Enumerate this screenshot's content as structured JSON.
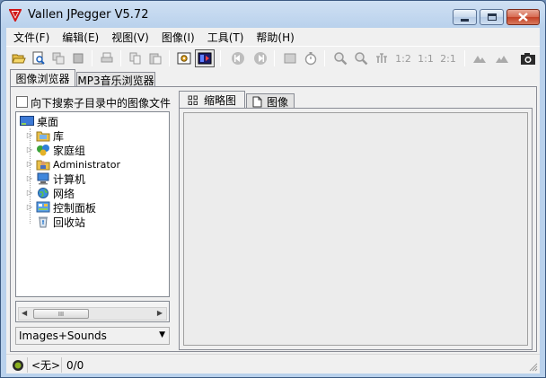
{
  "window": {
    "title": "Vallen JPegger V5.72"
  },
  "menu": [
    {
      "id": "file",
      "label": "文件(F)"
    },
    {
      "id": "edit",
      "label": "编辑(E)"
    },
    {
      "id": "view",
      "label": "视图(V)"
    },
    {
      "id": "image",
      "label": "图像(I)"
    },
    {
      "id": "tools",
      "label": "工具(T)"
    },
    {
      "id": "help",
      "label": "帮助(H)"
    }
  ],
  "toolbar": {
    "zoom_half": "1:2",
    "zoom_one": "1:1",
    "zoom_double": "2:1"
  },
  "tabs": {
    "image_browser": "图像浏览器",
    "mp3_browser": "MP3音乐浏览器"
  },
  "left_panel": {
    "subdir_search_label": "向下搜索子目录中的图像文件",
    "subdir_search_checked": false,
    "tree": [
      {
        "label": "桌面",
        "icon": "desktop-icon",
        "level": 0,
        "expandable": false
      },
      {
        "label": "库",
        "icon": "libraries-icon",
        "level": 1,
        "expandable": true
      },
      {
        "label": "家庭组",
        "icon": "homegroup-icon",
        "level": 1,
        "expandable": true
      },
      {
        "label": "Administrator",
        "icon": "user-folder-icon",
        "level": 1,
        "expandable": true
      },
      {
        "label": "计算机",
        "icon": "computer-icon",
        "level": 1,
        "expandable": true
      },
      {
        "label": "网络",
        "icon": "network-icon",
        "level": 1,
        "expandable": true
      },
      {
        "label": "控制面板",
        "icon": "control-panel-icon",
        "level": 1,
        "expandable": true
      },
      {
        "label": "回收站",
        "icon": "recycle-bin-icon",
        "level": 1,
        "expandable": false
      }
    ],
    "scrollbar_grip": "III",
    "filter_selected": "Images+Sounds"
  },
  "right_panel": {
    "tab_thumbnails": "缩略图",
    "tab_image": "图像"
  },
  "status": {
    "selection": "<无>",
    "count": "0/0"
  },
  "colors": {
    "title_gradient_top": "#cfe0f3",
    "title_gradient_bottom": "#b9d1ec",
    "close_button": "#c34025",
    "face": "#f0f0f0",
    "view_area": "#ececec"
  }
}
